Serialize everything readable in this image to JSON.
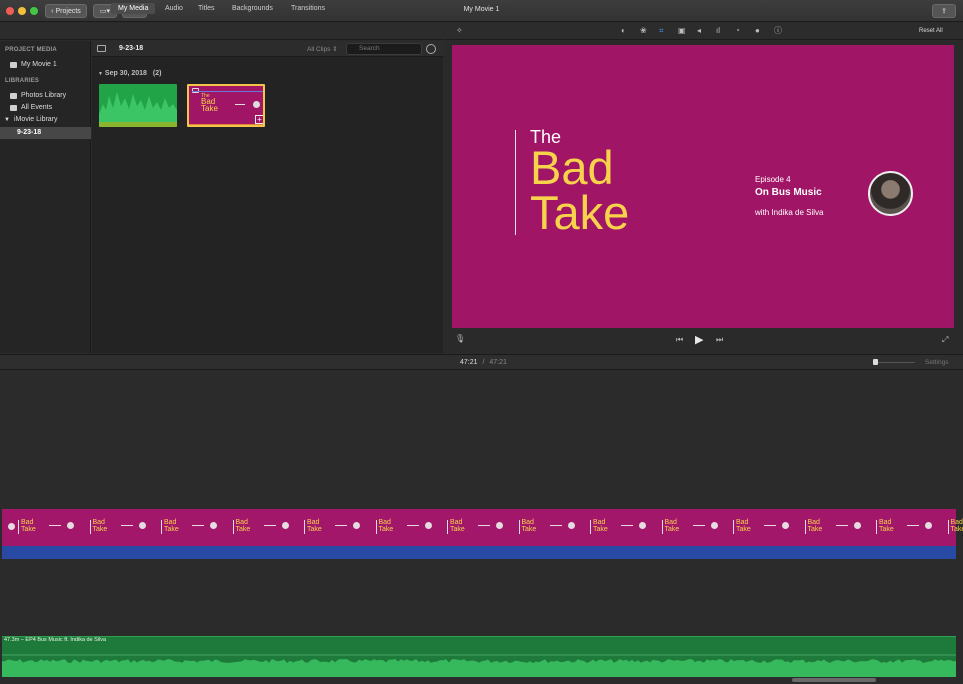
{
  "window": {
    "title": "My Movie 1",
    "projects_button": "Projects"
  },
  "media_tabs": [
    {
      "label": "My Media",
      "active": true
    },
    {
      "label": "Audio",
      "active": false
    },
    {
      "label": "Titles",
      "active": false
    },
    {
      "label": "Backgrounds",
      "active": false
    },
    {
      "label": "Transitions",
      "active": false
    }
  ],
  "sidebar": {
    "project_media_heading": "PROJECT MEDIA",
    "project_item": "My Movie 1",
    "libraries_heading": "LIBRARIES",
    "photos_library": "Photos Library",
    "all_events": "All Events",
    "imovie_library": "iMovie Library",
    "event_selected": "9-23-18"
  },
  "browser": {
    "event_name": "9-23-18",
    "filter_label": "All Clips",
    "search_placeholder": "Search",
    "group_date": "Sep 30, 2018",
    "group_count": "(2)",
    "thumb_title_line1": "The",
    "thumb_title_line2": "Bad",
    "thumb_title_line3": "Take"
  },
  "viewer": {
    "reset_all": "Reset All",
    "title_the": "The",
    "title_bad": "Bad",
    "title_take": "Take",
    "episode": "Episode 4",
    "episode_title": "On Bus Music",
    "host": "with Indika de Silva"
  },
  "timeline": {
    "current_time": "47:21",
    "separator": "/",
    "total_time": "47:21",
    "settings_label": "Settings",
    "audio_clip_label": "47.3m – EP4 Bus Music ft. Indika de Silva",
    "filmstrip_line1": "Bad",
    "filmstrip_line2": "Take"
  },
  "colors": {
    "title_magenta": "#a01566",
    "title_yellow": "#f6d34a",
    "audio_green": "#1e7a3a",
    "blue_track": "#2849a4"
  }
}
